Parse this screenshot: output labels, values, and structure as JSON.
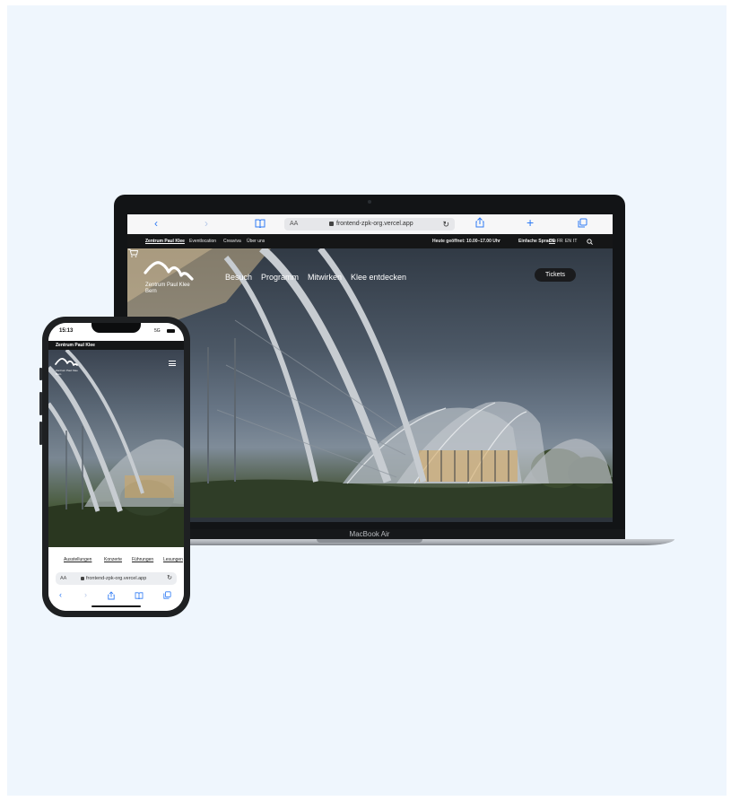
{
  "laptop": {
    "model_label": "MacBook Air",
    "browser": {
      "aa_label": "AA",
      "url": "frontend-zpk-org.vercel.app",
      "icons": [
        "back-icon",
        "forward-icon",
        "bookmarks-icon",
        "reload-icon",
        "share-icon",
        "new-tab-icon",
        "tabs-icon"
      ]
    },
    "site": {
      "topbar": {
        "brand": "Zentrum Paul Klee",
        "links": [
          "Eventlocation",
          "Creaviva",
          "Über uns"
        ],
        "opening": "Heute geöffnet: 10.00–17.00 Uhr",
        "easy_language": "Einfache Sprache",
        "languages": [
          "DE",
          "FR",
          "EN",
          "IT"
        ],
        "active_language": "DE"
      },
      "logo": {
        "line1": "Zentrum Paul Klee",
        "line2": "Bern"
      },
      "nav": [
        "Besuch",
        "Programm",
        "Mitwirken",
        "Klee entdecken"
      ],
      "tickets_label": "Tickets"
    }
  },
  "phone": {
    "status": {
      "time": "15:13",
      "network": "5G"
    },
    "topbar_brand": "Zentrum Paul Klee",
    "logo": {
      "line1": "Zentrum Paul Klee",
      "line2": "Bern"
    },
    "categories": [
      "Ausstellungen",
      "Konzerte",
      "Führungen",
      "Lesungen"
    ],
    "browser": {
      "aa_label": "AA",
      "url": "frontend-zpk-org.vercel.app"
    }
  },
  "colors": {
    "background": "#eff6fd",
    "safari_blue": "#2f7bf5",
    "topbar": "#151617"
  }
}
